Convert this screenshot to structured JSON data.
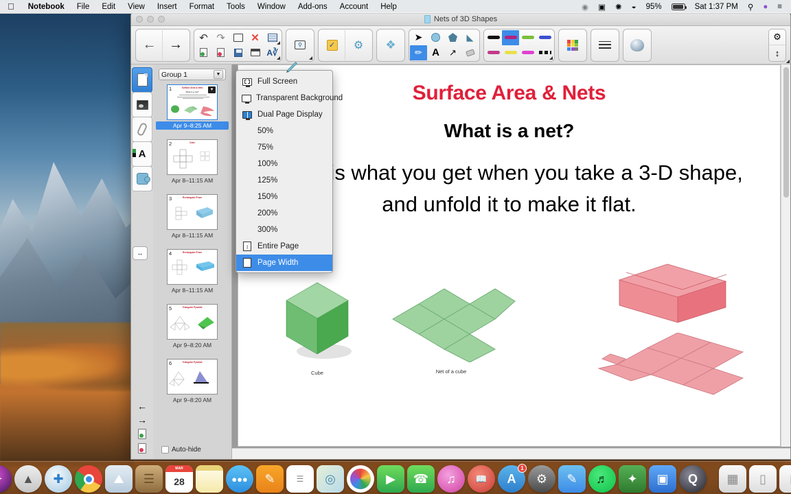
{
  "menubar": {
    "apple_icon": "apple-logo",
    "items": [
      {
        "label": "Notebook",
        "bold": true
      },
      {
        "label": "File",
        "bold": false
      },
      {
        "label": "Edit",
        "bold": false
      },
      {
        "label": "View",
        "bold": false
      },
      {
        "label": "Insert",
        "bold": false
      },
      {
        "label": "Format",
        "bold": false
      },
      {
        "label": "Tools",
        "bold": false
      },
      {
        "label": "Window",
        "bold": false
      },
      {
        "label": "Add-ons",
        "bold": false
      },
      {
        "label": "Account",
        "bold": false
      },
      {
        "label": "Help",
        "bold": false
      }
    ],
    "status": {
      "battery_percent": "95%",
      "clock": "Sat 1:37 PM",
      "icons": [
        "screen-record-icon",
        "video-icon",
        "bluetooth-share-icon",
        "wifi-icon",
        "battery-icon",
        "spotlight-search-icon",
        "siri-icon",
        "notification-center-icon"
      ]
    }
  },
  "window": {
    "title": "Nets of 3D Shapes",
    "traffic_lights": [
      "close-button",
      "minimize-button",
      "zoom-button"
    ]
  },
  "toolbar": {
    "groups": [
      {
        "name": "navigation",
        "buttons": [
          {
            "name": "previous-page-button",
            "glyph": "←"
          },
          {
            "name": "next-page-button",
            "glyph": "→"
          }
        ]
      },
      {
        "name": "file-edit",
        "cells": [
          {
            "name": "undo-button",
            "glyph": "↰"
          },
          {
            "name": "redo-button",
            "glyph": "↱"
          },
          {
            "name": "open-file-button",
            "glyph": "open"
          },
          {
            "name": "delete-button",
            "glyph": "✕"
          },
          {
            "name": "insert-table-button",
            "glyph": "table"
          },
          {
            "name": "new-page-button",
            "glyph": "newpage"
          },
          {
            "name": "delete-page-button",
            "glyph": "delpage"
          },
          {
            "name": "save-button",
            "glyph": "save"
          },
          {
            "name": "screen-shade-button",
            "glyph": "shade"
          },
          {
            "name": "measurement-tools-button",
            "glyph": "measure"
          }
        ]
      },
      {
        "name": "screen-capture",
        "buttons": [
          {
            "name": "screen-capture-button",
            "glyph": "capture"
          }
        ]
      },
      {
        "name": "activities",
        "buttons": [
          {
            "name": "response-button",
            "glyph": "checkbox"
          },
          {
            "name": "lab-activity-button",
            "glyph": "lab"
          }
        ]
      },
      {
        "name": "gallery",
        "buttons": [
          {
            "name": "gallery-button",
            "glyph": "gallery"
          }
        ]
      },
      {
        "name": "tools",
        "cells": [
          {
            "name": "select-tool",
            "glyph": "cursor"
          },
          {
            "name": "shapes-tool",
            "glyph": "shapes"
          },
          {
            "name": "shape-pen-tool",
            "glyph": "shapepen"
          },
          {
            "name": "fill-tool",
            "glyph": "fill"
          },
          {
            "name": "pens-tool",
            "glyph": "pens",
            "selected": true
          },
          {
            "name": "text-tool",
            "glyph": "A"
          },
          {
            "name": "line-tool",
            "glyph": "line"
          },
          {
            "name": "eraser-tool",
            "glyph": "eraser"
          }
        ]
      },
      {
        "name": "pen-styles",
        "cells": [
          {
            "name": "pen-style-black",
            "color": "#111111"
          },
          {
            "name": "pen-style-magenta",
            "color": "#b5227f",
            "selected": true
          },
          {
            "name": "pen-style-green",
            "color": "#7bbf3a"
          },
          {
            "name": "pen-style-blue",
            "color": "#3c4fd0"
          },
          {
            "name": "pen-style-pink",
            "color": "#c23a8a"
          },
          {
            "name": "pen-style-yellow",
            "color": "#e8e04a"
          },
          {
            "name": "pen-style-violet",
            "color": "#e040d0"
          },
          {
            "name": "pen-style-dashed",
            "color": "#111111"
          }
        ]
      },
      {
        "name": "color-palette",
        "buttons": [
          {
            "name": "color-palette-button",
            "glyph": "palette"
          }
        ]
      },
      {
        "name": "line-properties",
        "buttons": [
          {
            "name": "line-properties-button",
            "glyph": "lineprops"
          }
        ]
      },
      {
        "name": "3d-tools",
        "buttons": [
          {
            "name": "three-d-object-button",
            "glyph": "sphere"
          }
        ]
      }
    ],
    "right_controls": [
      {
        "name": "settings-gear-button",
        "glyph": "⚙"
      },
      {
        "name": "expand-toolbar-button",
        "glyph": "⇕"
      }
    ]
  },
  "sidebar": {
    "tabs": [
      {
        "name": "page-sorter-tab",
        "icon": "page-icon",
        "active": true
      },
      {
        "name": "gallery-tab",
        "icon": "picture-icon",
        "active": false
      },
      {
        "name": "attachments-tab",
        "icon": "paperclip-icon",
        "active": false
      },
      {
        "name": "properties-tab",
        "icon": "format-a-icon",
        "active": false
      },
      {
        "name": "add-ons-tab",
        "icon": "puzzle-icon",
        "active": false
      }
    ],
    "group_selector": {
      "label": "Group 1",
      "caret": "▼"
    },
    "thumbnails": [
      {
        "number": "1",
        "date": "Apr 9–8:25 AM",
        "active": true,
        "title": "Surface Area & Nets",
        "subtitle": "What is a net?"
      },
      {
        "number": "2",
        "date": "Apr 8–11:15 AM",
        "active": false,
        "title": "Cube",
        "subtitle": ""
      },
      {
        "number": "3",
        "date": "Apr 8–11:15 AM",
        "active": false,
        "title": "Rectangular Prism",
        "subtitle": ""
      },
      {
        "number": "4",
        "date": "Apr 8–11:15 AM",
        "active": false,
        "title": "Rectangular Prism",
        "subtitle": ""
      },
      {
        "number": "5",
        "date": "Apr 9–8:20 AM",
        "active": false,
        "title": "Triangular Pyramid",
        "subtitle": ""
      },
      {
        "number": "6",
        "date": "Apr 9–8:20 AM",
        "active": false,
        "title": "Triangular Pyramid",
        "subtitle": ""
      }
    ],
    "auto_hide": {
      "label": "Auto-hide",
      "checked": false
    },
    "bottom_controls": [
      {
        "name": "page-back-button",
        "glyph": "←"
      },
      {
        "name": "page-forward-button",
        "glyph": "→"
      },
      {
        "name": "add-page-button",
        "glyph": "add-page-icon"
      },
      {
        "name": "remove-page-button",
        "glyph": "remove-page-icon"
      }
    ],
    "resize_handle": {
      "name": "panel-resize-handle",
      "glyph": "↔"
    }
  },
  "view_menu": {
    "items": [
      {
        "label": "Full Screen",
        "icon": "full-screen-icon",
        "highlighted": false
      },
      {
        "label": "Transparent Background",
        "icon": "transparent-background-icon",
        "highlighted": false
      },
      {
        "label": "Dual Page Display",
        "icon": "dual-page-icon",
        "highlighted": false
      },
      {
        "label": "50%",
        "icon": "",
        "highlighted": false
      },
      {
        "label": "75%",
        "icon": "",
        "highlighted": false
      },
      {
        "label": "100%",
        "icon": "",
        "highlighted": false
      },
      {
        "label": "125%",
        "icon": "",
        "highlighted": false
      },
      {
        "label": "150%",
        "icon": "",
        "highlighted": false
      },
      {
        "label": "200%",
        "icon": "",
        "highlighted": false
      },
      {
        "label": "300%",
        "icon": "",
        "highlighted": false
      },
      {
        "label": "Entire Page",
        "icon": "entire-page-icon",
        "highlighted": false
      },
      {
        "label": "Page Width",
        "icon": "page-width-icon",
        "highlighted": true
      }
    ],
    "highlight_color": "#3d8ce8"
  },
  "canvas": {
    "title": "Surface Area & Nets",
    "title_color": "#e0203a",
    "subtitle": "What is a net?",
    "body": "A net is what you get when you take a 3-D shape, and unfold it to make it flat.",
    "figures": [
      {
        "name": "cube-figure",
        "label": "Cube",
        "color": "#7cc47f"
      },
      {
        "name": "cube-net-figure",
        "label": "Net of a cube",
        "color": "#9ed3a0"
      },
      {
        "name": "rectangular-prism-figure",
        "label": "",
        "color": "#e8838c"
      },
      {
        "name": "rectangular-prism-net-figure",
        "label": "",
        "color": "#efa0a7"
      }
    ]
  },
  "dock": {
    "items": [
      {
        "name": "finder",
        "glyph": "☺",
        "bg": "linear-gradient(#5cb3ea,#2d7fcc)",
        "running": true
      },
      {
        "name": "siri",
        "glyph": "✦",
        "bg": "radial-gradient(circle at 40% 35%,#d94fd0,#3b1560)",
        "running": false
      },
      {
        "name": "launchpad",
        "glyph": "🚀",
        "bg": "linear-gradient(#e9e9e9,#c6c6c6)",
        "running": false
      },
      {
        "name": "safari",
        "glyph": "✜",
        "bg": "radial-gradient(circle at 40% 35%,#f6f9fb,#bcd8ea)",
        "running": true
      },
      {
        "name": "chrome",
        "glyph": "◉",
        "bg": "conic-gradient(#e8453c 0 33%,#f7c744 0 60%,#2fa84f 0 85%,#e8453c 0)",
        "running": true
      },
      {
        "name": "photos-preview",
        "glyph": "▣",
        "bg": "linear-gradient(#dfe8ef,#b7cbdc)",
        "running": true
      },
      {
        "name": "contacts",
        "glyph": "▤",
        "bg": "linear-gradient(#c9a876,#8d6b3e)",
        "running": false
      },
      {
        "name": "calendar",
        "glyph": "28",
        "bg": "#ffffff",
        "running": false
      },
      {
        "name": "notes",
        "glyph": "▤",
        "bg": "linear-gradient(#fdf6cf,#f5e9a8)",
        "running": false
      },
      {
        "name": "messages",
        "glyph": "💬",
        "bg": "linear-gradient(#5cc2f5,#2d8fe0)",
        "running": true
      },
      {
        "name": "pages",
        "glyph": "✎",
        "bg": "linear-gradient(#f8a62a,#e8831a)",
        "running": true
      },
      {
        "name": "reminders",
        "glyph": "☰",
        "bg": "#ffffff",
        "running": false
      },
      {
        "name": "maps",
        "glyph": "⌖",
        "bg": "linear-gradient(#e8f1d8,#bcd9e8)",
        "running": false
      },
      {
        "name": "photos",
        "glyph": "❀",
        "bg": "conic-gradient(#e8453c,#f7c744,#2fa84f,#3d8ce8,#9b4fd0,#e8453c)",
        "running": false
      },
      {
        "name": "facetime-green",
        "glyph": "▶",
        "bg": "linear-gradient(#6fdc5c,#2fa84f)",
        "running": false
      },
      {
        "name": "messages-green",
        "glyph": "✆",
        "bg": "linear-gradient(#6fdc5c,#2fa84f)",
        "running": false
      },
      {
        "name": "itunes",
        "glyph": "♪",
        "bg": "radial-gradient(circle at 40% 35%,#f08fd8,#d0409f)",
        "running": false
      },
      {
        "name": "ibooks",
        "glyph": "📖",
        "bg": "linear-gradient(#f07a6a,#d0413c)",
        "running": false
      },
      {
        "name": "app-store",
        "glyph": "A",
        "bg": "linear-gradient(#5cb3ea,#2d7fcc)",
        "running": false,
        "badge": "1"
      },
      {
        "name": "system-preferences",
        "glyph": "⚙",
        "bg": "linear-gradient(#8e8e8e,#4a4a4a)",
        "running": false
      },
      {
        "name": "smart-notebook",
        "glyph": "✎",
        "bg": "linear-gradient(#5cb3ea,#3d8ce8)",
        "running": true
      },
      {
        "name": "spotify",
        "glyph": "♬",
        "bg": "radial-gradient(circle at 40% 35%,#4ae87a,#0ec24a)",
        "running": true
      },
      {
        "name": "geogebra",
        "glyph": "✧",
        "bg": "linear-gradient(#4fa84f,#2f7a2f)",
        "running": true
      },
      {
        "name": "zoom",
        "glyph": "▣",
        "bg": "linear-gradient(#4f9cf5,#2d6fd0)",
        "running": true
      },
      {
        "name": "quicktime",
        "glyph": "Q",
        "bg": "radial-gradient(circle at 40% 35%,#7a7a88,#2a2a33)",
        "running": true
      },
      {
        "name": "downloads-stack",
        "glyph": "▤",
        "bg": "linear-gradient(#fafafa,#d8d8d8)",
        "running": false
      },
      {
        "name": "document-stack-1",
        "glyph": "▭",
        "bg": "linear-gradient(#fdfdfd,#dedede)",
        "running": false
      },
      {
        "name": "document-stack-2",
        "glyph": "▭",
        "bg": "linear-gradient(#fdfdfd,#dedede)",
        "running": false
      },
      {
        "name": "trash",
        "glyph": "🗑",
        "bg": "linear-gradient(#e8e8e8,#c2c2c2)",
        "running": false
      }
    ]
  }
}
